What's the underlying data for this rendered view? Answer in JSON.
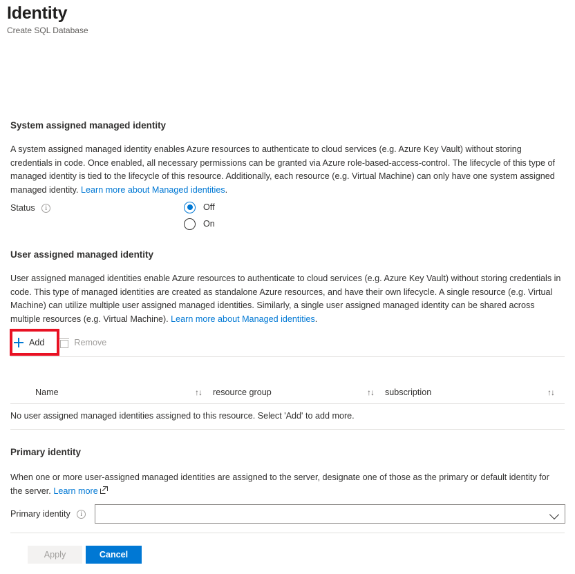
{
  "header": {
    "title": "Identity",
    "subtitle": "Create SQL Database"
  },
  "system_identity": {
    "heading": "System assigned managed identity",
    "description_part1": "A system assigned managed identity enables Azure resources to authenticate to cloud services (e.g. Azure Key Vault) without storing credentials in code. Once enabled, all necessary permissions can be granted via Azure role-based-access-control. The lifecycle of this type of managed identity is tied to the lifecycle of this resource. Additionally, each resource (e.g. Virtual Machine) can only have one system assigned managed identity. ",
    "link_text": "Learn more about Managed identities",
    "description_part2": ".",
    "status_label": "Status",
    "options": [
      {
        "label": "Off",
        "selected": true
      },
      {
        "label": "On",
        "selected": false
      }
    ]
  },
  "user_identity": {
    "heading": "User assigned managed identity",
    "description_part1": "User assigned managed identities enable Azure resources to authenticate to cloud services (e.g. Azure Key Vault) without storing credentials in code. This type of managed identities are created as standalone Azure resources, and have their own lifecycle. A single resource (e.g. Virtual Machine) can utilize multiple user assigned managed identities. Similarly, a single user assigned managed identity can be shared across multiple resources (e.g. Virtual Machine). ",
    "link_text": "Learn more about Managed identities",
    "description_part2": ".",
    "toolbar": {
      "add_label": "Add",
      "remove_label": "Remove"
    },
    "table": {
      "columns": [
        "Name",
        "resource group",
        "subscription"
      ],
      "sort_glyph": "↑↓",
      "empty_message": "No user assigned managed identities assigned to this resource. Select 'Add' to add more."
    }
  },
  "primary_identity": {
    "heading": "Primary identity",
    "description": "When one or more user-assigned managed identities are assigned to the server, designate one of those as the primary or default identity for the server. ",
    "link_text": "Learn more",
    "field_label": "Primary identity",
    "dropdown_value": ""
  },
  "footer": {
    "apply_label": "Apply",
    "cancel_label": "Cancel"
  },
  "colors": {
    "accent": "#0078d4",
    "highlight": "#e81123",
    "text": "#323130",
    "disabled_text": "#a19f9d",
    "divider": "#e1dfdd"
  }
}
